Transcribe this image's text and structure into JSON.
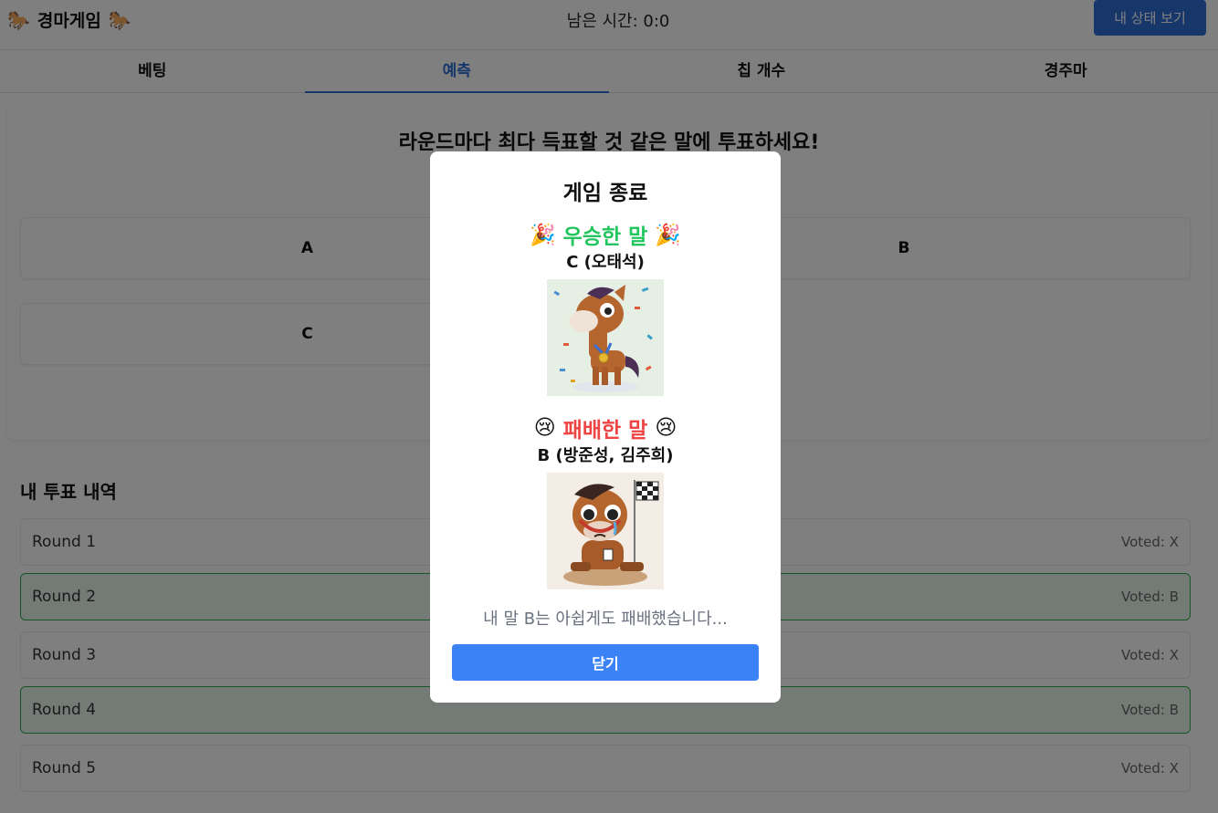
{
  "header": {
    "title": "경마게임",
    "timer": "남은 시간: 0:0",
    "status_button": "내 상태 보기"
  },
  "tabs": [
    {
      "label": "베팅"
    },
    {
      "label": "예측"
    },
    {
      "label": "칩 개수"
    },
    {
      "label": "경주마"
    }
  ],
  "prediction": {
    "prompt": "라운드마다 최다 득표할 것 같은 말에 투표하세요!",
    "options": [
      "A",
      "B",
      "C"
    ]
  },
  "history": {
    "title": "내 투표 내역",
    "rounds": [
      {
        "name": "Round 1",
        "vote": "Voted: X"
      },
      {
        "name": "Round 2",
        "vote": "Voted: B"
      },
      {
        "name": "Round 3",
        "vote": "Voted: X"
      },
      {
        "name": "Round 4",
        "vote": "Voted: B"
      },
      {
        "name": "Round 5",
        "vote": "Voted: X"
      }
    ]
  },
  "modal": {
    "title": "게임 종료",
    "winner_label": "우승한 말",
    "winner_names": "C (오태석)",
    "loser_label": "패배한 말",
    "loser_names": "B (방준성, 김주희)",
    "message": "내 말 B는 아쉽게도 패배했습니다...",
    "close_button": "닫기",
    "winner_color": "#22c55e",
    "loser_color": "#ef4444",
    "button_color": "#3b82f6"
  },
  "icons": {
    "header": "horse-icon",
    "winner": "party-popper-icon",
    "loser": "crying-face-icon"
  }
}
